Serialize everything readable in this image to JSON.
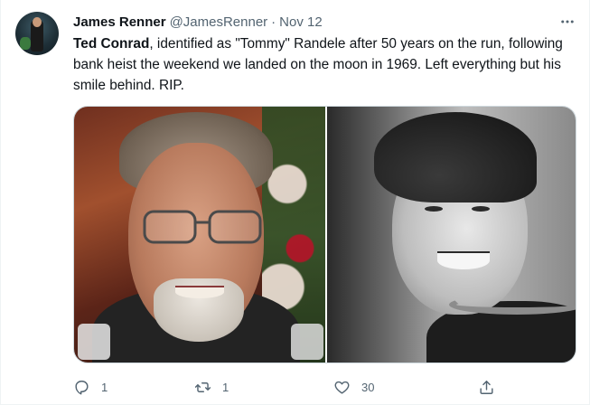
{
  "author": {
    "name": "James Renner",
    "handle": "@JamesRenner",
    "separator": "·",
    "date": "Nov 12"
  },
  "tweet": {
    "text_bold": "Ted Conrad",
    "text_rest": ", identified as \"Tommy\" Randele after 50 years on the run, following bank heist the weekend we landed on the moon in 1969. Left everything but his smile behind. RIP."
  },
  "media": {
    "images": [
      {
        "name": "photo-older-man-smiling"
      },
      {
        "name": "photo-young-man-smiling"
      }
    ]
  },
  "actions": {
    "reply_count": "1",
    "retweet_count": "1",
    "like_count": "30",
    "share_count": ""
  },
  "icons": {
    "more": "more-horizontal-icon",
    "reply": "reply-icon",
    "retweet": "retweet-icon",
    "like": "heart-icon",
    "share": "share-icon"
  },
  "colors": {
    "text_primary": "#0f1419",
    "text_secondary": "#536471",
    "border": "#cfd9de"
  }
}
